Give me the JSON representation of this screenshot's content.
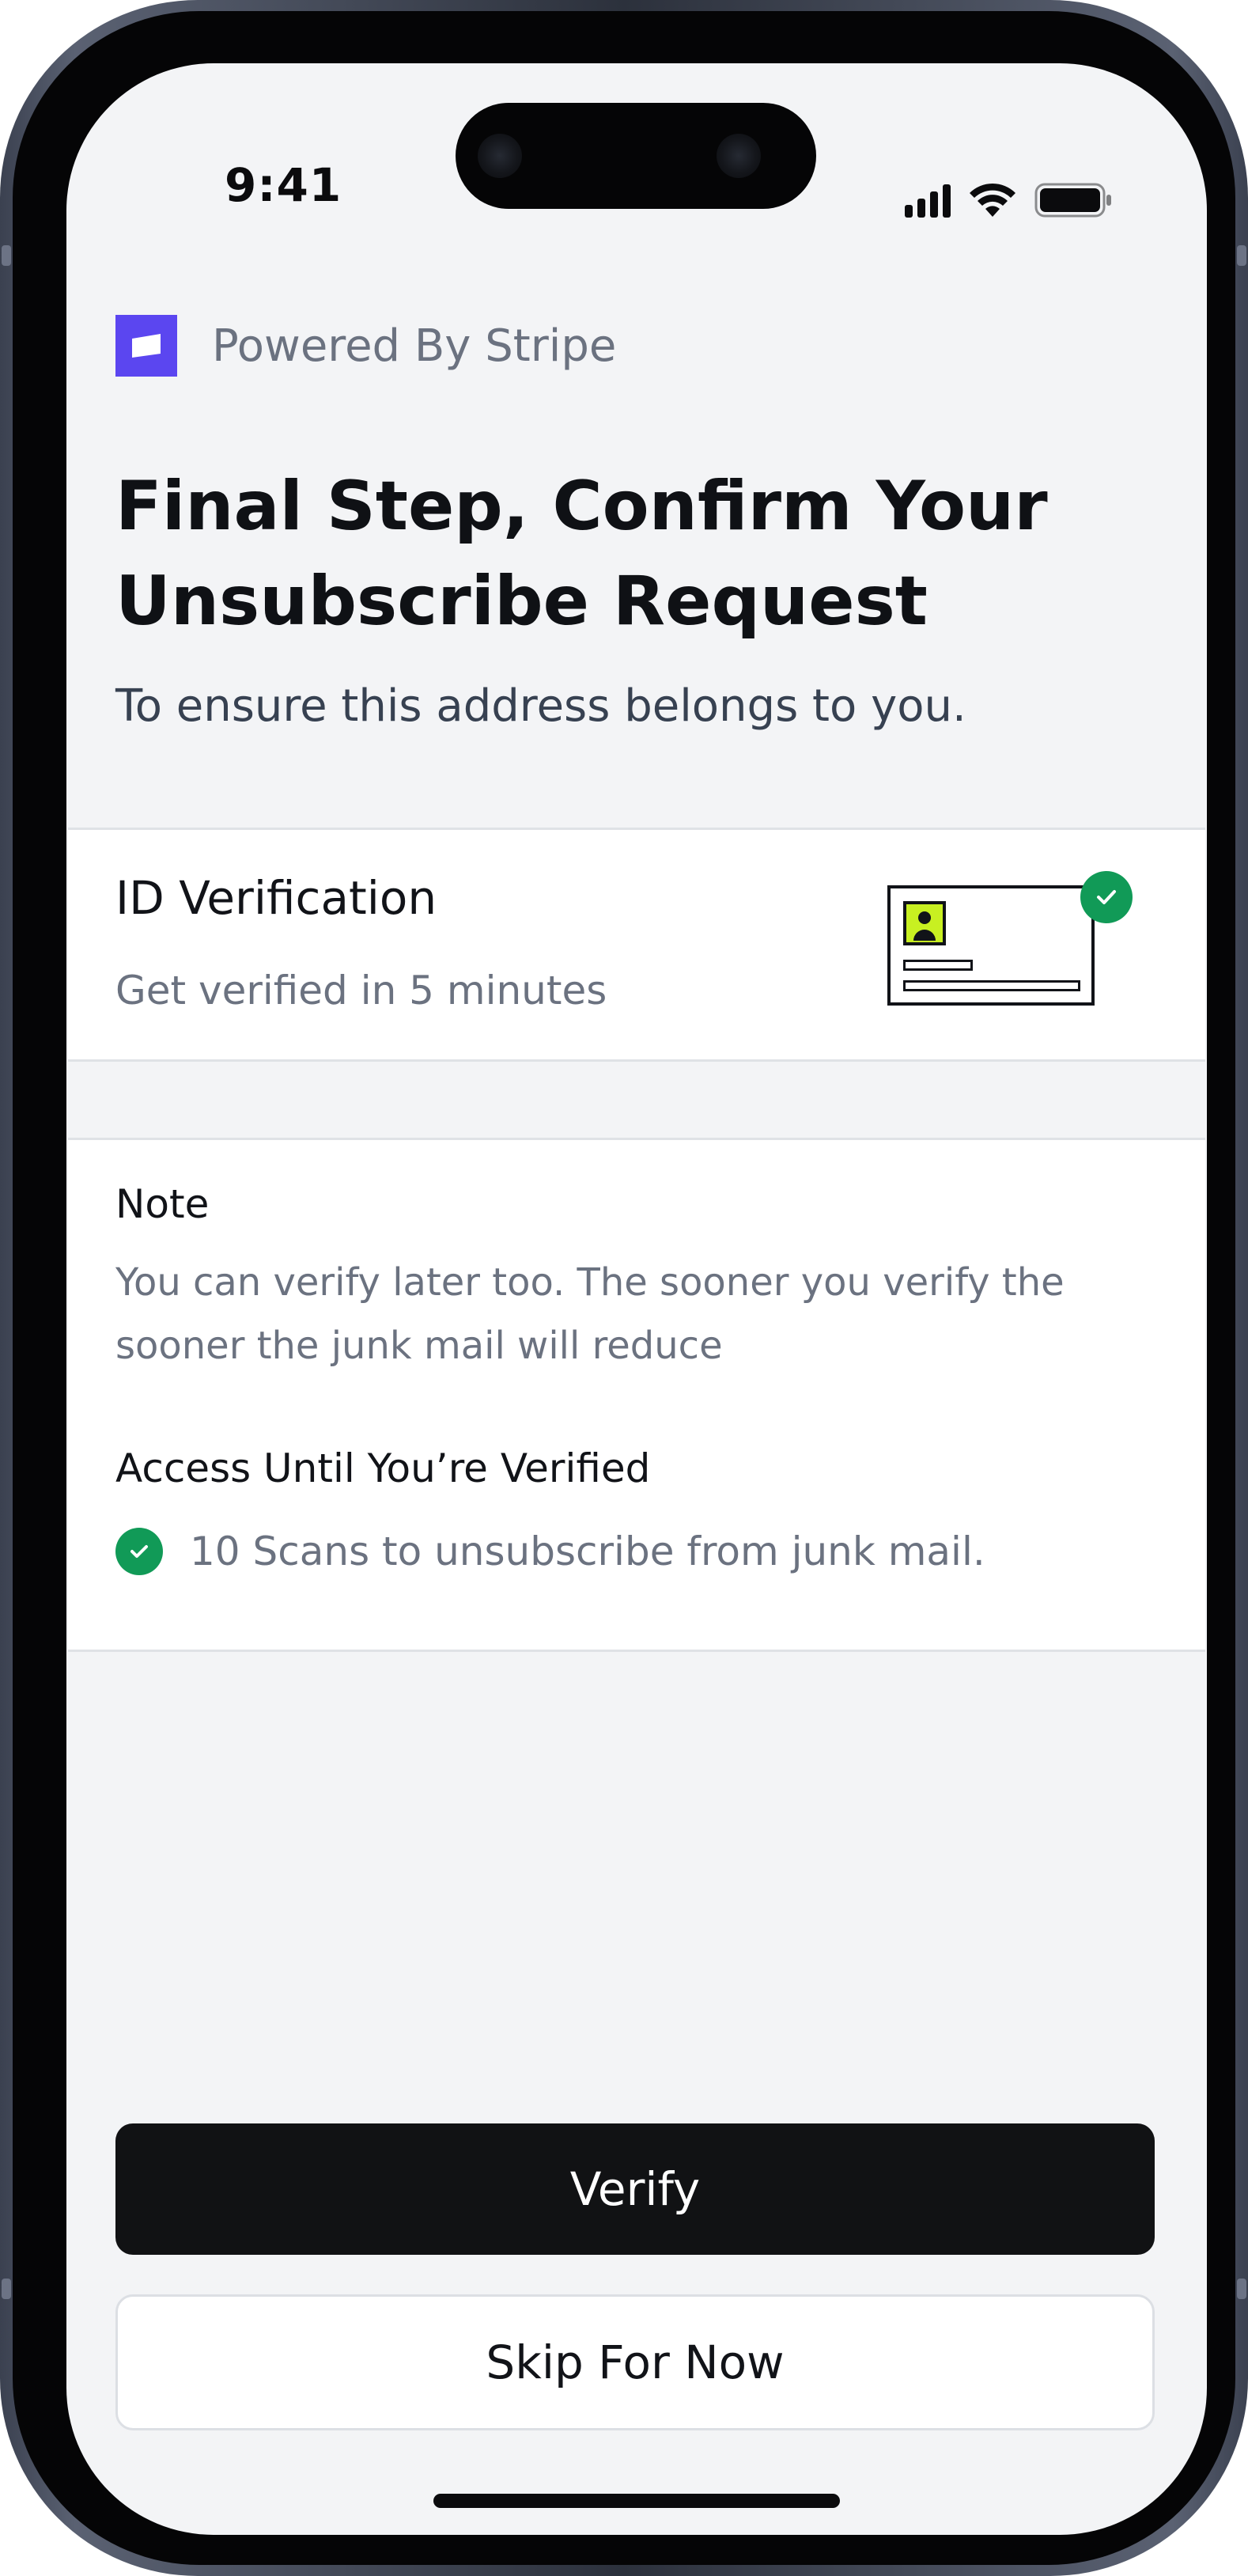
{
  "status_bar": {
    "time": "9:41",
    "icons": [
      "cellular-signal-icon",
      "wifi-icon",
      "battery-icon"
    ]
  },
  "brand": {
    "label": "Powered By Stripe",
    "logo_icon": "stripe-logo-icon",
    "accent_color": "#5b46f0"
  },
  "header": {
    "title": "Final Step, Confirm Your Unsubscribe Request",
    "subtitle": "To ensure this address belongs to you."
  },
  "id_card": {
    "title": "ID Verification",
    "subtitle": "Get verified in 5 minutes",
    "illustration_icon": "id-card-icon",
    "verified_icon": "check-circle-icon",
    "photo_color": "#c8f021"
  },
  "note_card": {
    "note_title": "Note",
    "note_body": "You can verify later too. The sooner you verify the sooner the junk mail will reduce",
    "access_title": "Access Until You’re Verified",
    "access_items": [
      {
        "icon": "check-circle-icon",
        "text": "10 Scans to unsubscribe from junk mail."
      }
    ],
    "success_color": "#119a57"
  },
  "actions": {
    "verify_label": "Verify",
    "skip_label": "Skip For Now"
  }
}
